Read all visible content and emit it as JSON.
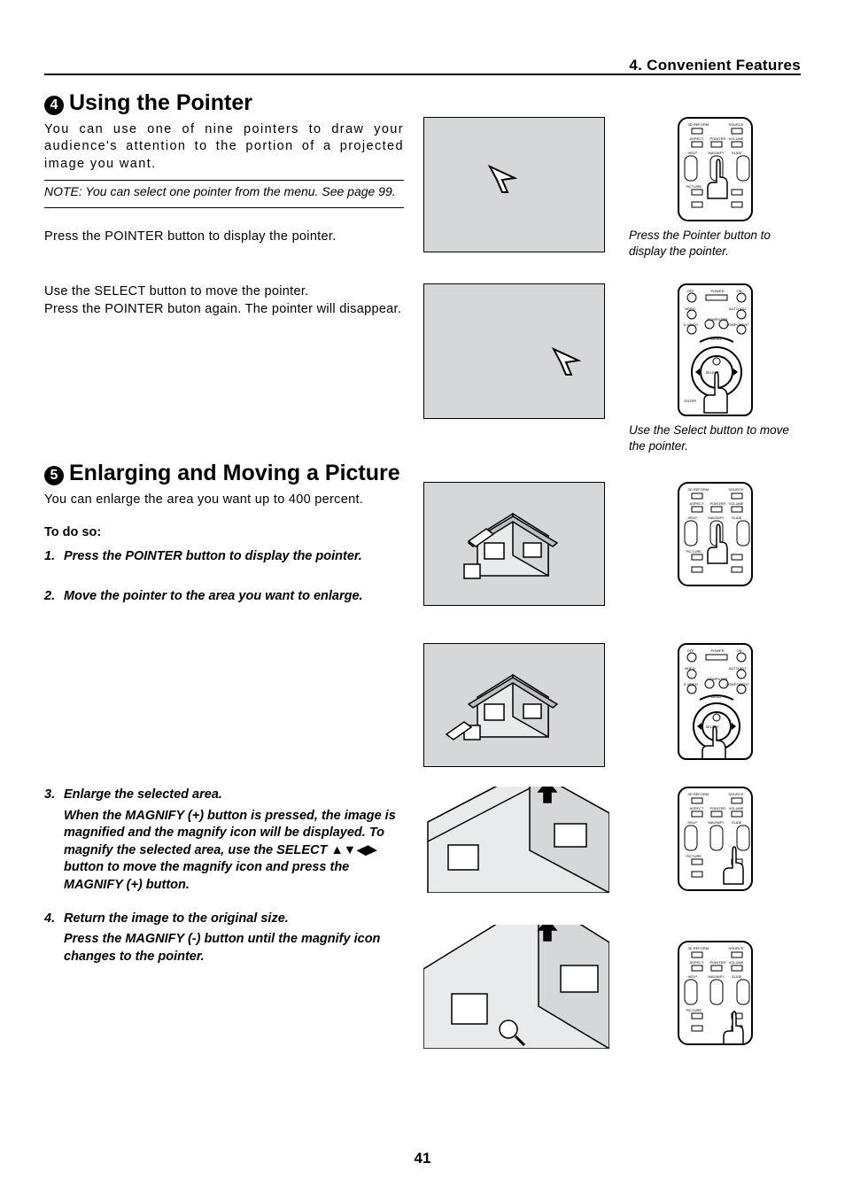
{
  "chapter_label": "4. Convenient Features",
  "pointer": {
    "num": "4",
    "title": "Using the Pointer",
    "intro": "You can use one of nine pointers to draw your audience's attention to the portion of a projected image you want.",
    "note": "NOTE: You can select one pointer from the menu. See page 99.",
    "p1": "Press the POINTER button to display the pointer.",
    "p2": "Use the SELECT button to move the pointer.\nPress the POINTER buton again. The pointer will disappear.",
    "cap1": "Press the Pointer button to display the pointer.",
    "cap2": "Use the Select button to move the pointer."
  },
  "enlarge": {
    "num": "5",
    "title": "Enlarging and Moving a Picture",
    "intro": "You can enlarge the area you want up to 400 percent.",
    "todo": "To do so:",
    "s1": "Press the POINTER button to display the pointer.",
    "s2": "Move the pointer to the area you want to enlarge.",
    "s3": "Enlarge the selected area.",
    "s3b": "When the MAGNIFY (+) button is pressed, the image is magnified and the magnify icon will be displayed. To magnify the selected area, use the SELECT ▲▼◀▶ button to move the magnify icon and press the MAGNIFY (+) button.",
    "s4": "Return the image to the original size.",
    "s4b": "Press the MAGNIFY (-) button until the magnify icon changes to the pointer."
  },
  "remote_labels": {
    "l1": "3D REFORM",
    "l2": "SOURCE",
    "l3": "ASPECT",
    "l4": "POINTER",
    "l5": "VOLUME",
    "l6": "HELP",
    "l7": "MAGNIFY",
    "l8": "SLIDE",
    "l9": "PICTURE",
    "off": "OFF",
    "on": "ON",
    "power": "POWER",
    "video": "VIDEO",
    "svideo": "S-VIDEO",
    "computer": "COMPUTER",
    "component": "COMPONENT",
    "autoadj": "AUTO ADJ.",
    "menu": "MENU",
    "select": "SELECT",
    "enter": "ENTER"
  },
  "page_number": "41"
}
